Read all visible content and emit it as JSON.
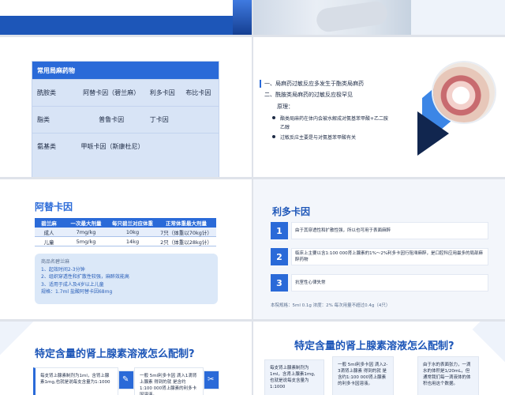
{
  "colors": {
    "primary": "#2a6ad8",
    "dark": "#1d56b8",
    "light": "#dbe8f8"
  },
  "table_slide": {
    "header": "常用局麻药物",
    "rows": [
      {
        "c1": "酰胺类",
        "c2": "阿替卡因（碧兰麻）",
        "c3": "利多卡因",
        "c4": "布比卡因"
      },
      {
        "c1": "脂类",
        "c2": "普鲁卡因",
        "c3": "丁卡因",
        "c4": ""
      },
      {
        "c1": "氨基类",
        "c2": "甲哌卡因（斯康杜尼）",
        "c3": "",
        "c4": ""
      }
    ]
  },
  "teeth_slide": {
    "point1": "一、局麻药过敏反应多发生于酯类局麻药",
    "point2": "二、酰胺类局麻药的过敏反应极罕见",
    "principle_label": "原理：",
    "bullet1_line1": "酯类局麻药在体内会被水解成对氨基苯甲酸+乙二胺",
    "bullet1_line2": "乙醇",
    "bullet2": "过敏反应主要是与对氨基苯甲酸有关"
  },
  "atc_slide": {
    "title": "阿替卡因",
    "headers": [
      "碧兰麻",
      "一次最大剂量",
      "每只碧兰对应体重",
      "正常体重最大剂量"
    ],
    "rows": [
      [
        "成人",
        "7mg/kg",
        "10kg",
        "7只（体重以70kg计）"
      ],
      [
        "儿童",
        "5mg/kg",
        "14kg",
        "2只（体重以28kg计）"
      ]
    ],
    "box_title": "商品名碧兰麻",
    "box_lines": [
      "1、起效时间2-3分钟",
      "2、组织穿透性和扩散性较强，麻醉效能高",
      "3、适用于成人及4岁以上儿童"
    ],
    "box_spec": "规格：1.7ml 盐酸阿替卡因68mg"
  },
  "lido_slide": {
    "title": "利多卡因",
    "items": [
      {
        "num": "1",
        "text": "由于其穿透性和扩散性强，所以也可用于表面麻醉"
      },
      {
        "num": "2",
        "text": "临床上主要以含1:100 000肾上腺素的1%～2%利多卡因行阻滞麻醉，是口腔科应用最多的局部麻醉药物"
      },
      {
        "num": "3",
        "text": "抗室性心律失常"
      }
    ],
    "footer": "本院规格：5ml 0.1g 浓度：2% 每次用量不超过0.4g（4只）"
  },
  "adr_left": {
    "title": "特定含量的肾上腺素溶液怎么配制?",
    "card1": "每支肾上腺素制剂为1ml，含肾上腺素1mg,也就是说每支含量为1:1000",
    "card2": "一般 5ml利多卡因 滴入1滴肾上腺素 得到的就 是含约1:100 000肾上腺素的利多卡因溶液。"
  },
  "adr_right": {
    "title": "特定含量的肾上腺素溶液怎么配制?",
    "card1": "每支肾上腺素制剂为1ml，含肾上腺素1mg,也就是说每支含量为1:1000",
    "card2": "一般 5ml利多卡因 滴入2-3滴肾上腺素 得到的就 是含约1:100 000肾上腺素的利多卡因溶液。",
    "card3": "由于水的表面张力，一滴水的体积是1/20mL，但通常我们每一滴液体的体积也用这个数据。"
  }
}
